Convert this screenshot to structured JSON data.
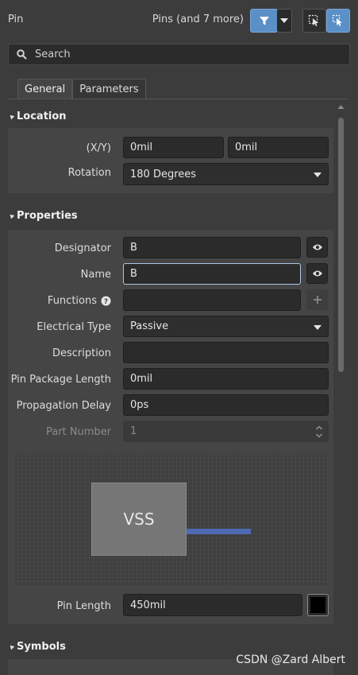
{
  "header": {
    "title": "Pin",
    "filter_label": "Pins (and 7 more)",
    "filter_icon": "funnel-icon",
    "dropdown_icon": "caret-down-icon",
    "select_icon_1": "select-inside-icon",
    "select_icon_2": "select-touching-icon"
  },
  "search": {
    "label": "Search",
    "icon": "search-icon"
  },
  "tabs": [
    {
      "label": "General",
      "active": true
    },
    {
      "label": "Parameters",
      "active": false
    }
  ],
  "location": {
    "title": "Location",
    "xy_label": "(X/Y)",
    "x_value": "0mil",
    "y_value": "0mil",
    "rotation_label": "Rotation",
    "rotation_value": "180 Degrees"
  },
  "properties": {
    "title": "Properties",
    "designator_label": "Designator",
    "designator_value": "B",
    "name_label": "Name",
    "name_value": "B",
    "functions_label": "Functions",
    "functions_value": "",
    "electrical_type_label": "Electrical Type",
    "electrical_type_value": "Passive",
    "description_label": "Description",
    "description_value": "",
    "pin_package_length_label": "Pin Package Length",
    "pin_package_length_value": "0mil",
    "propagation_delay_label": "Propagation Delay",
    "propagation_delay_value": "0ps",
    "part_number_label": "Part Number",
    "part_number_value": "1",
    "preview_name": "VSS",
    "pin_length_label": "Pin Length",
    "pin_length_value": "450mil",
    "pin_color": "#000000",
    "pin_line_color": "#4d6ab3"
  },
  "symbols": {
    "title": "Symbols"
  },
  "watermark": "CSDN @Zard Albert"
}
